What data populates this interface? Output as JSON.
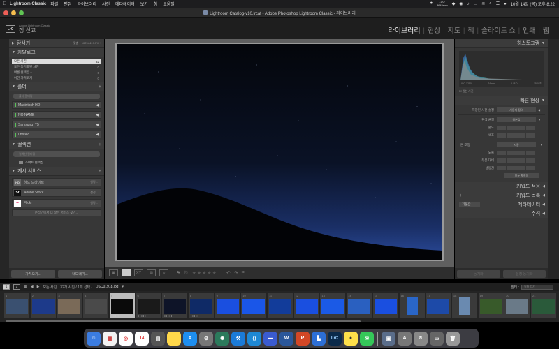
{
  "menubar": {
    "app_name": "Lightroom Classic",
    "items": [
      "파일",
      "편집",
      "라이브러리",
      "사진",
      "메타데이터",
      "보기",
      "창",
      "도움말"
    ],
    "temp": "48°C",
    "rpm": "3645rpm",
    "datetime": "10월 14일 (목) 오후 8:22"
  },
  "window": {
    "title": "Lightroom Catalog-v10.lrcat - Adobe Photoshop Lightroom Classic - 라이브러리"
  },
  "header": {
    "logo": "LrC",
    "brand": "Adobe Lightroom Classic",
    "user": "정 선교",
    "modules": [
      "라이브러리",
      "현상",
      "지도",
      "책",
      "슬라이드 쇼",
      "인쇄",
      "웹"
    ],
    "active_module": "라이브러리"
  },
  "left_panel": {
    "navigator": {
      "title": "탐색기",
      "zoom": "맞춤 ÷  100%  419.7% ÷"
    },
    "catalog": {
      "title": "카탈로그",
      "items": [
        {
          "label": "모든 사진",
          "count": "32"
        },
        {
          "label": "모든 동기화된 사진",
          "count": "0"
        },
        {
          "label": "빠른 컬렉션 +",
          "count": "0"
        },
        {
          "label": "이전 가져오기",
          "count": "0"
        }
      ]
    },
    "folders": {
      "title": "폴더",
      "search_placeholder": "폴더 필터링",
      "volumes": [
        "Macintosh HD",
        "NO NAME",
        "Samsung_T5",
        "untitled"
      ]
    },
    "collections": {
      "title": "컬렉션",
      "search_placeholder": "컬렉션 필터링",
      "items": [
        "스마트 컬렉션"
      ]
    },
    "publish": {
      "title": "게시 서비스",
      "services": [
        {
          "label": "하드 드라이브",
          "setup": "설정...",
          "icon": "HD"
        },
        {
          "label": "Adobe Stock",
          "setup": "설정...",
          "icon": "St"
        },
        {
          "label": "Flickr",
          "setup": "설정...",
          "icon": "••"
        }
      ],
      "find_more": "온라인에서 더 많은 서비스 찾기..."
    },
    "import_label": "가져오기...",
    "export_label": "내보내기..."
  },
  "right_panel": {
    "histogram": {
      "title": "히스토그램",
      "iso": "ISO 1250",
      "focal": "24mm",
      "aperture": "f / 8.0",
      "shutter": "15.0 초",
      "original_label": "원본 사진"
    },
    "quick_develop": {
      "title": "빠른 현상",
      "preset_label": "저장된 사전 설정",
      "preset_value": "사용자 정의",
      "wb_label": "흰색 균형",
      "wb_value": "원본값",
      "temp_label": "온도",
      "tint_label": "색조",
      "tone_label": "톤 조정",
      "tone_value": "자동",
      "exposure_label": "노출",
      "texture_label": "부분 대비",
      "vibrance_label": "생동감",
      "reset_label": "모두 재설정"
    },
    "keywording": "키워드 적용",
    "keyword_list": "키워드 목록",
    "metadata": "메타데이터",
    "metadata_preset": "기본값",
    "comments": "주석",
    "sync_label": "동기화",
    "sync_settings_label": "설정 동기화"
  },
  "filmstrip": {
    "pages": [
      "1",
      "2"
    ],
    "source": "모든 사진",
    "info": "32개 사진 / 1개 선택 /",
    "filename": "DSC01918.jpg",
    "filter_label": "필터 :",
    "filter_value": "필터 끄기",
    "numbers": [
      "1",
      "2",
      "3",
      "4",
      "5",
      "6",
      "7",
      "8",
      "9",
      "10",
      "11",
      "12",
      "13",
      "14",
      "15",
      "16",
      "17",
      "18",
      "19",
      "20",
      "21"
    ]
  },
  "dock": {
    "calendar_day": "14"
  }
}
